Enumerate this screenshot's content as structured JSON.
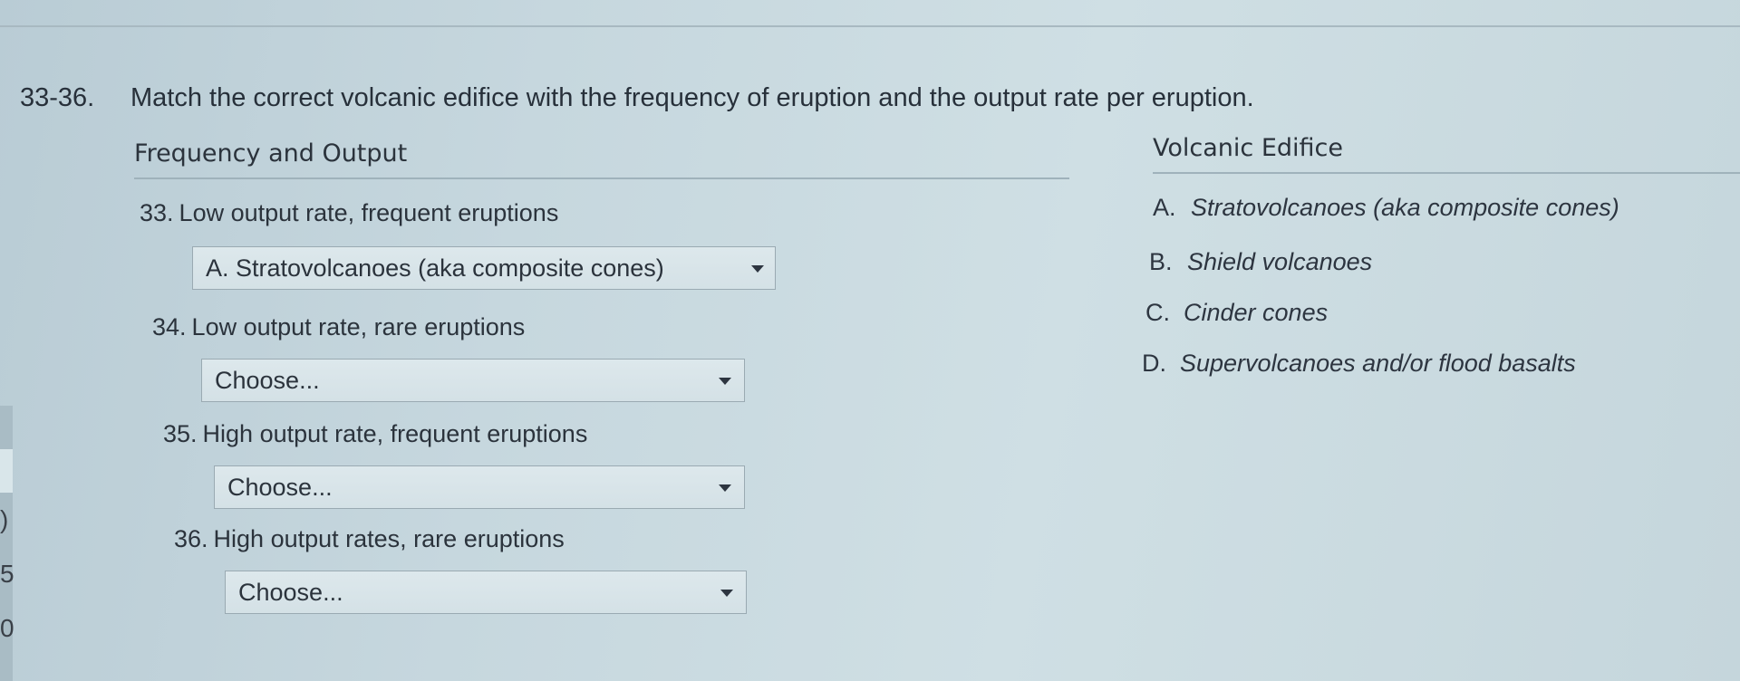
{
  "question": {
    "number": "33-36.",
    "prompt": "Match the correct volcanic edifice with the frequency of eruption and the output rate per eruption."
  },
  "columns": {
    "left_title": "Frequency and Output",
    "right_title": "Volcanic Edifice"
  },
  "items": [
    {
      "number": "33.",
      "label": "Low output rate, frequent eruptions",
      "selected": "A. Stratovolcanoes (aka composite cones)"
    },
    {
      "number": "34.",
      "label": "Low output rate, rare eruptions",
      "selected": "Choose..."
    },
    {
      "number": "35.",
      "label": "High output rate, frequent eruptions",
      "selected": "Choose..."
    },
    {
      "number": "36.",
      "label": "High output rates, rare eruptions",
      "selected": "Choose..."
    }
  ],
  "options": [
    {
      "letter": "A.",
      "text": "Stratovolcanoes (aka composite cones)"
    },
    {
      "letter": "B.",
      "text": "Shield volcanoes"
    },
    {
      "letter": "C.",
      "text": "Cinder cones"
    },
    {
      "letter": "D.",
      "text": "Supervolcanoes and/or flood basalts"
    }
  ],
  "edge_fragments": [
    ")",
    "5",
    "0"
  ]
}
